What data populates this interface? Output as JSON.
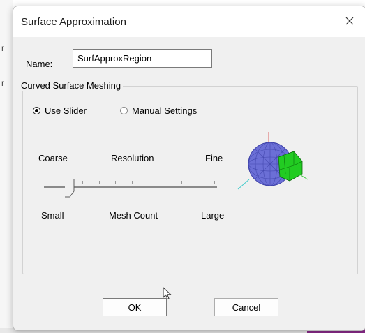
{
  "dialog": {
    "title": "Surface Approximation",
    "close_glyph": "✕"
  },
  "name_field": {
    "label": "Name:",
    "value": "SurfApproxRegion"
  },
  "group": {
    "title": "Curved Surface Meshing"
  },
  "mode": {
    "use_slider_label": "Use Slider",
    "manual_label": "Manual Settings",
    "selected": "Use Slider"
  },
  "slider": {
    "top_left": "Coarse",
    "top_center": "Resolution",
    "top_right": "Fine",
    "bottom_left": "Small",
    "bottom_center": "Mesh Count",
    "bottom_right": "Large",
    "tick_count": 11,
    "position_fraction": 0.12
  },
  "buttons": {
    "ok": "OK",
    "cancel": "Cancel"
  },
  "background": {
    "fragment": "r"
  },
  "colors": {
    "sphere": "#6b6fd6",
    "mesh_patch": "#22cc22",
    "window_bg": "#f0f0f0"
  },
  "icons": {
    "close": "close-icon",
    "cursor": "mouse-cursor-icon",
    "preview": "mesh-sphere-preview-icon"
  }
}
